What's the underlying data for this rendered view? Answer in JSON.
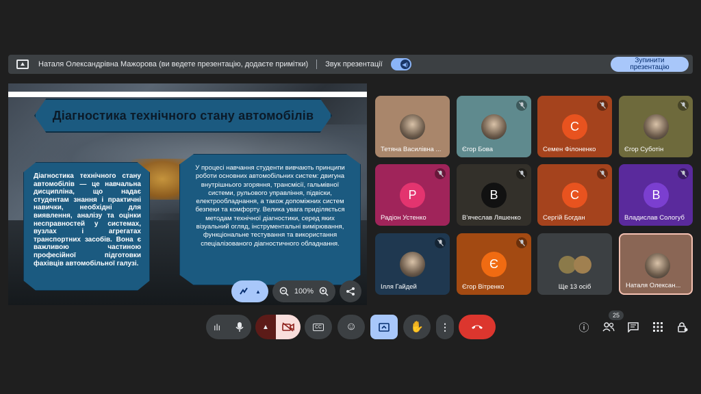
{
  "banner": {
    "presenter_text": "Наталя Олександрівна Мажорова (ви ведете презентацію, додаєте примітки)",
    "sound_label": "Звук презентації",
    "stop_button": "Зупинити презентацію"
  },
  "slide": {
    "title": "Діагностика технічного стану автомобілів",
    "left_text": "Діагностика технічного стану автомобілів — це навчальна дисципліна, що надає студентам знання і практичні навички, необхідні для виявлення, аналізу та оцінки несправностей у системах, вузлах і агрегатах транспортних засобів. Вона є важливою частиною професійної підготовки фахівців автомобільної галузі.",
    "right_text": "У процесі навчання студенти вивчають принципи роботи основних автомобільних систем: двигуна внутрішнього згоряння, трансмісії, гальмівної системи, рульового управління, підвіски, електрообладнання, а також допоміжних систем безпеки та комфорту. Велика увага приділяється методам технічної діагностики, серед яких візуальний огляд, інструментальні вимірювання, функціональне тестування та використання спеціалізованого діагностичного обладнання.",
    "zoom": "100%"
  },
  "participants": [
    {
      "name": "Тетяна Василівна ...",
      "initial": "",
      "muted": false,
      "bg": "#a9866b"
    },
    {
      "name": "Єгор Бова",
      "initial": "",
      "muted": true,
      "bg": "#5f8a8e"
    },
    {
      "name": "Семен Філоненко",
      "initial": "С",
      "muted": true,
      "bg": "#a5431d",
      "avatar": "#e8531f"
    },
    {
      "name": "Єгор Суботін",
      "initial": "",
      "muted": true,
      "bg": "#6e6a3c"
    },
    {
      "name": "Радіон Устенко",
      "initial": "Р",
      "muted": true,
      "bg": "#a0245a",
      "avatar": "#e3346f"
    },
    {
      "name": "В'ячеслав Ляшенко",
      "initial": "В",
      "muted": true,
      "bg": "#33302a",
      "avatar": "#111111"
    },
    {
      "name": "Сергій Богдан",
      "initial": "С",
      "muted": true,
      "bg": "#a5431d",
      "avatar": "#e8531f"
    },
    {
      "name": "Владислав Сологуб",
      "initial": "В",
      "muted": true,
      "bg": "#5a2a9c",
      "avatar": "#7b3fd0"
    },
    {
      "name": "Ілля Гайдей",
      "initial": "",
      "muted": true,
      "bg": "#1f3850"
    },
    {
      "name": "Єгор Вітренко",
      "initial": "Є",
      "muted": true,
      "bg": "#a34a12",
      "avatar": "#f06b12"
    },
    {
      "name": "Ще 13 осіб",
      "initial": "",
      "muted": false,
      "bg": "#3c4043"
    },
    {
      "name": "Наталя Олексан...",
      "initial": "",
      "muted": false,
      "bg": "#8a6655"
    }
  ],
  "controls": {
    "participant_count": "25"
  },
  "icons": [
    "present-icon",
    "sound-icon",
    "annotate-icon",
    "zoom-out-icon",
    "zoom-in-icon",
    "share-icon",
    "audio-levels-icon",
    "mic-icon",
    "camera-off-icon",
    "captions-icon",
    "emoji-icon",
    "present-screen-icon",
    "raise-hand-icon",
    "more-icon",
    "end-call-icon",
    "info-icon",
    "people-icon",
    "chat-icon",
    "activities-icon",
    "host-controls-icon",
    "mic-off-icon"
  ]
}
